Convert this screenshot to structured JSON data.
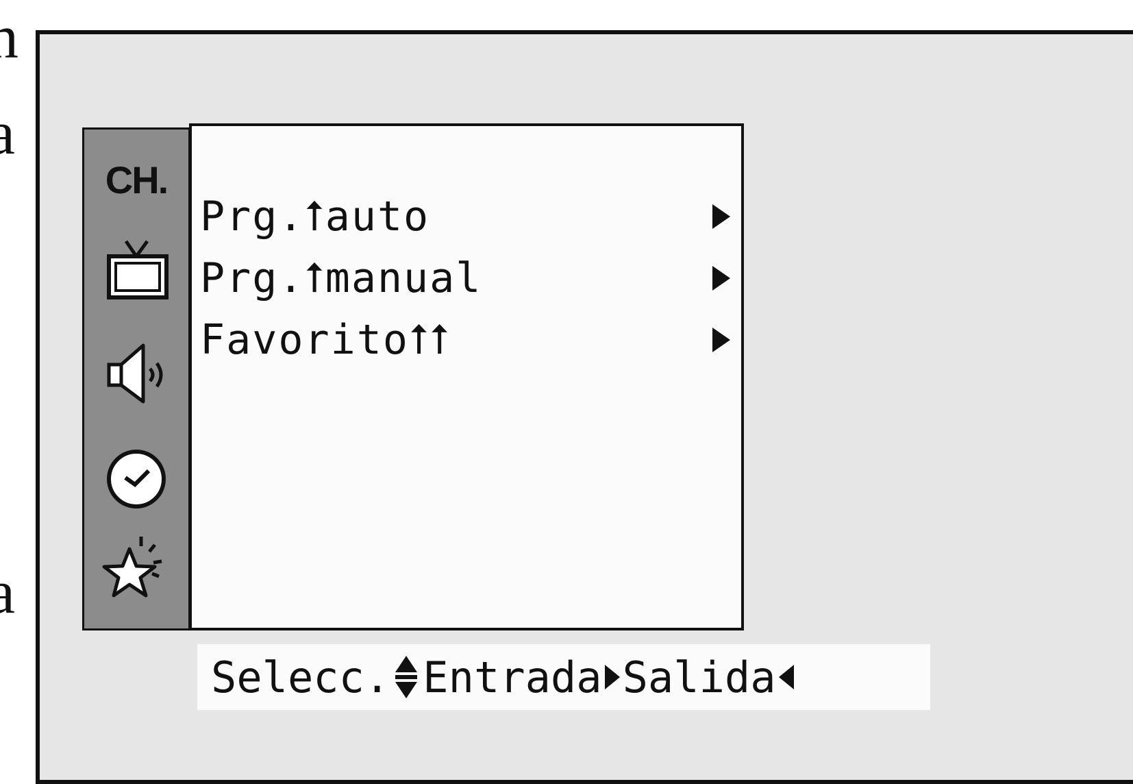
{
  "margin_letters": [
    "n",
    "a",
    "a"
  ],
  "sidebar": {
    "ch_label": "CH.",
    "icons": [
      "tv-icon",
      "speaker-icon",
      "clock-icon",
      "star-icon"
    ]
  },
  "menu": {
    "items": [
      {
        "label": "Prg.⭡auto",
        "icon": "right-arrow-icon"
      },
      {
        "label": "Prg.⭡manual",
        "icon": "right-arrow-icon"
      },
      {
        "label": "Favorito⭡⭡",
        "icon": "right-arrow-icon"
      }
    ]
  },
  "help": {
    "select": "Selecc.",
    "enter": "Entrada",
    "exit": "Salida"
  }
}
